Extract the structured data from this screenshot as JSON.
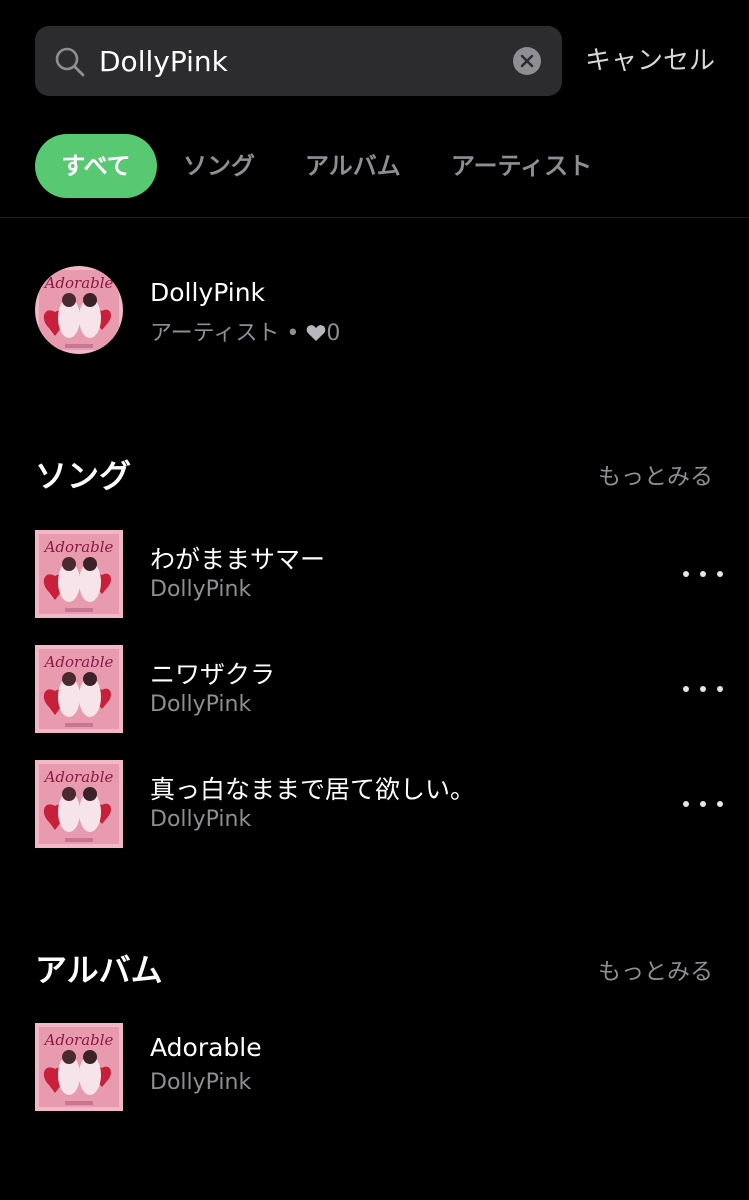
{
  "search": {
    "value": "DollyPink",
    "cancel_label": "キャンセル"
  },
  "tabs": [
    {
      "label": "すべて",
      "active": true
    },
    {
      "label": "ソング"
    },
    {
      "label": "アルバム"
    },
    {
      "label": "アーティスト"
    }
  ],
  "artist": {
    "name": "DollyPink",
    "type_label": "アーティスト",
    "separator": "•",
    "likes": "0"
  },
  "songs_section": {
    "title": "ソング",
    "more_label": "もっとみる",
    "items": [
      {
        "title": "わがままサマー",
        "artist": "DollyPink"
      },
      {
        "title": "ニワザクラ",
        "artist": "DollyPink"
      },
      {
        "title": "真っ白なままで居て欲しい。",
        "artist": "DollyPink"
      }
    ]
  },
  "albums_section": {
    "title": "アルバム",
    "more_label": "もっとみる",
    "items": [
      {
        "title": "Adorable",
        "artist": "DollyPink"
      }
    ]
  },
  "artwork": {
    "text": "Adorable",
    "colors": {
      "bg": "#f3b8c8",
      "heart": "#c81f3a",
      "text": "#8a1a44"
    }
  },
  "colors": {
    "accent": "#58c872",
    "background": "#000000",
    "search_bg": "#2c2c2e",
    "muted": "#8e8e93"
  }
}
